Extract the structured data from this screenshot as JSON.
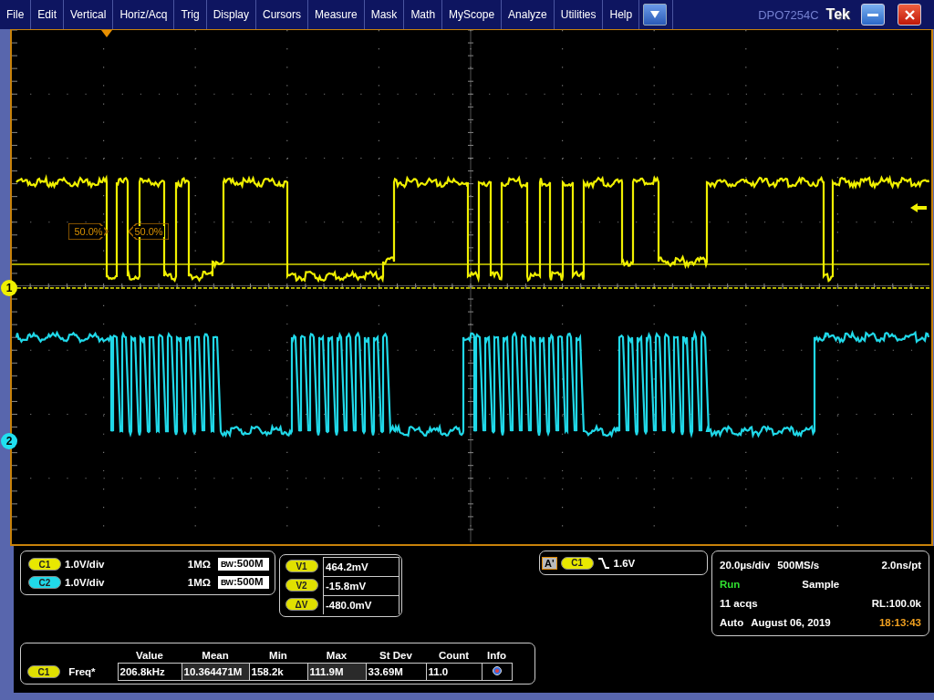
{
  "menu": [
    {
      "label": "File"
    },
    {
      "label": "Edit"
    },
    {
      "label": "Vertical"
    },
    {
      "label": "Horiz/Acq"
    },
    {
      "label": "Trig"
    },
    {
      "label": "Display"
    },
    {
      "label": "Cursors"
    },
    {
      "label": "Measure"
    },
    {
      "label": "Mask"
    },
    {
      "label": "Math"
    },
    {
      "label": "MyScope"
    },
    {
      "label": "Analyze"
    },
    {
      "label": "Utilities"
    },
    {
      "label": "Help"
    }
  ],
  "model": "DPO7254C",
  "brand": "Tek",
  "graticule": {
    "channel_markers": [
      {
        "label": "1",
        "color": "#f0f000"
      },
      {
        "label": "2",
        "color": "#20e0f0"
      }
    ],
    "cursor_readouts": [
      "50.0%",
      "50.0%"
    ]
  },
  "channels": [
    {
      "badge": "C1",
      "color": "#e8e800",
      "scale": "1.0V/div",
      "impedance": "1MΩ",
      "bandwidth": "$^{B}$$_{W}$:500M"
    },
    {
      "badge": "C2",
      "color": "#20d8e8",
      "scale": "1.0V/div",
      "impedance": "1MΩ",
      "bandwidth": "$^{B}$$_{W}$:500M"
    }
  ],
  "cursors": [
    {
      "badge": "V1",
      "value": "464.2mV"
    },
    {
      "badge": "V2",
      "value": "-15.8mV"
    },
    {
      "badge": "ΔV",
      "value": "-480.0mV"
    }
  ],
  "trigger": {
    "label": "A'",
    "source": "C1",
    "level": "1.6V"
  },
  "acquisition": {
    "timebase": "20.0µs/div",
    "sample_rate": "500MS/s",
    "resolution": "2.0ns/pt",
    "run_state": "Run",
    "mode": "Sample",
    "acqs": "11 acqs",
    "record_length": "RL:100.0k",
    "trigger_mode": "Auto",
    "date": "August 06, 2019",
    "time": "18:13:43"
  },
  "measurements": {
    "columns": [
      "Value",
      "Mean",
      "Min",
      "Max",
      "St Dev",
      "Count",
      "Info"
    ],
    "rows": [
      {
        "source": "C1",
        "name": "Freq*",
        "cells": [
          {
            "text": "206.8kHz",
            "shaded": false
          },
          {
            "text": "10.364471M",
            "shaded": true
          },
          {
            "text": "158.2k",
            "shaded": false
          },
          {
            "text": "111.9M",
            "shaded": true
          },
          {
            "text": "33.69M",
            "shaded": false
          },
          {
            "text": "11.0",
            "shaded": false
          }
        ]
      }
    ]
  }
}
